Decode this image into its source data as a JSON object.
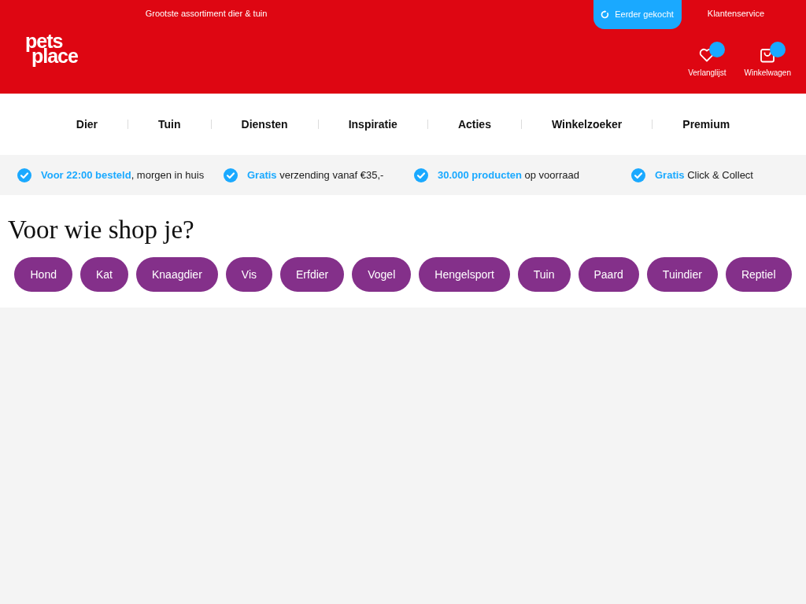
{
  "top_bar": {
    "tagline": "Grootste assortiment dier & tuin",
    "links": [
      {
        "label": "Eerder gekocht",
        "kind": "highlighted"
      },
      {
        "label": "Klantenservice",
        "kind": "plain"
      }
    ]
  },
  "logo": {
    "lines": [
      "pets",
      "place"
    ]
  },
  "header_actions": [
    {
      "label": "Verlanglijst",
      "kind": "wishlist",
      "badge": true
    },
    {
      "label": "Winkelwagen",
      "kind": "cart",
      "badge": true
    }
  ],
  "nav": {
    "items": [
      "Dier",
      "Tuin",
      "Diensten",
      "Inspiratie",
      "Acties",
      "Winkelzoeker",
      "Premium"
    ]
  },
  "usps": [
    {
      "highlight": "Voor 22:00 besteld",
      "text": ", morgen in huis"
    },
    {
      "highlight": "Gratis",
      "text": " verzending vanaf €35,-"
    },
    {
      "highlight": "30.000 producten",
      "text": " op voorraad"
    },
    {
      "highlight": "Gratis",
      "text": " Click & Collect"
    }
  ],
  "shop_for": {
    "title": "Voor wie shop je?",
    "categories": [
      "Hond",
      "Kat",
      "Knaagdier",
      "Vis",
      "Erfdier",
      "Vogel",
      "Hengelsport",
      "Tuin",
      "Paard",
      "Tuindier",
      "Reptiel"
    ]
  }
}
